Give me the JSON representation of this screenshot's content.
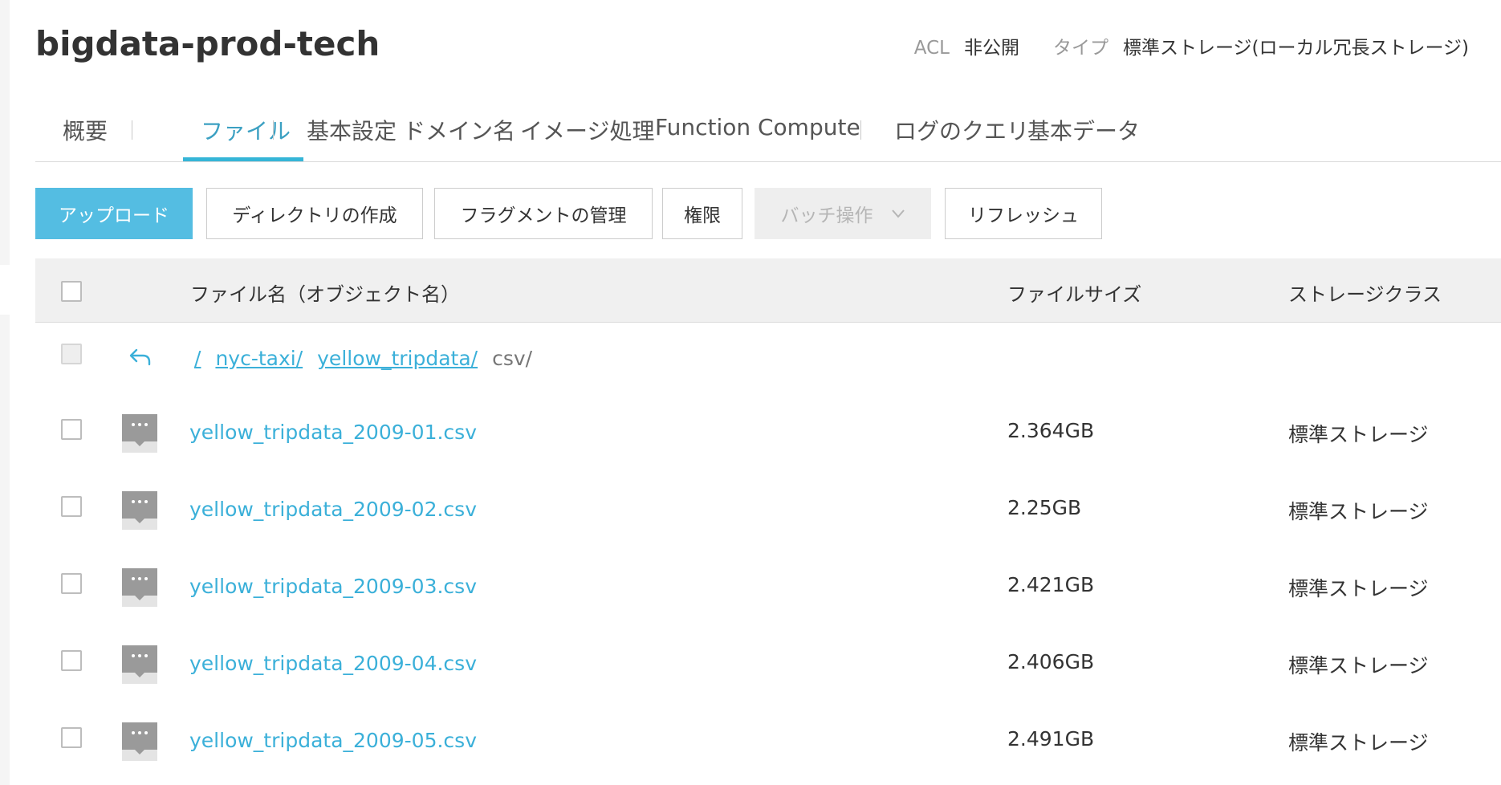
{
  "header": {
    "bucket_name": "bigdata-prod-tech",
    "acl_label": "ACL",
    "acl_value": "非公開",
    "type_label": "タイプ",
    "type_value": "標準ストレージ(ローカル冗長ストレージ)"
  },
  "tabs": [
    {
      "label": "概要"
    },
    {
      "label": "ファイル",
      "active": true
    },
    {
      "label": "基本設定"
    },
    {
      "label": "ドメイン名"
    },
    {
      "label": "イメージ処理"
    },
    {
      "label": "Function Compute"
    },
    {
      "label": "ログのクエリ"
    },
    {
      "label": "基本データ"
    }
  ],
  "toolbar": {
    "upload": "アップロード",
    "create_dir": "ディレクトリの作成",
    "fragments": "フラグメントの管理",
    "permissions": "権限",
    "batch": "バッチ操作",
    "refresh": "リフレッシュ"
  },
  "table": {
    "columns": {
      "name": "ファイル名（オブジェクト名）",
      "size": "ファイルサイズ",
      "class": "ストレージクラス"
    },
    "path": {
      "root": "/",
      "segments": [
        "nyc-taxi/",
        "yellow_tripdata/"
      ],
      "current": "csv/"
    },
    "rows": [
      {
        "name": "yellow_tripdata_2009-01.csv",
        "size": "2.364GB",
        "class": "標準ストレージ"
      },
      {
        "name": "yellow_tripdata_2009-02.csv",
        "size": "2.25GB",
        "class": "標準ストレージ"
      },
      {
        "name": "yellow_tripdata_2009-03.csv",
        "size": "2.421GB",
        "class": "標準ストレージ"
      },
      {
        "name": "yellow_tripdata_2009-04.csv",
        "size": "2.406GB",
        "class": "標準ストレージ"
      },
      {
        "name": "yellow_tripdata_2009-05.csv",
        "size": "2.491GB",
        "class": "標準ストレージ"
      }
    ]
  },
  "colors": {
    "accent": "#35b5d7",
    "link": "#3bb0d9",
    "primary_button": "#54bde2"
  }
}
